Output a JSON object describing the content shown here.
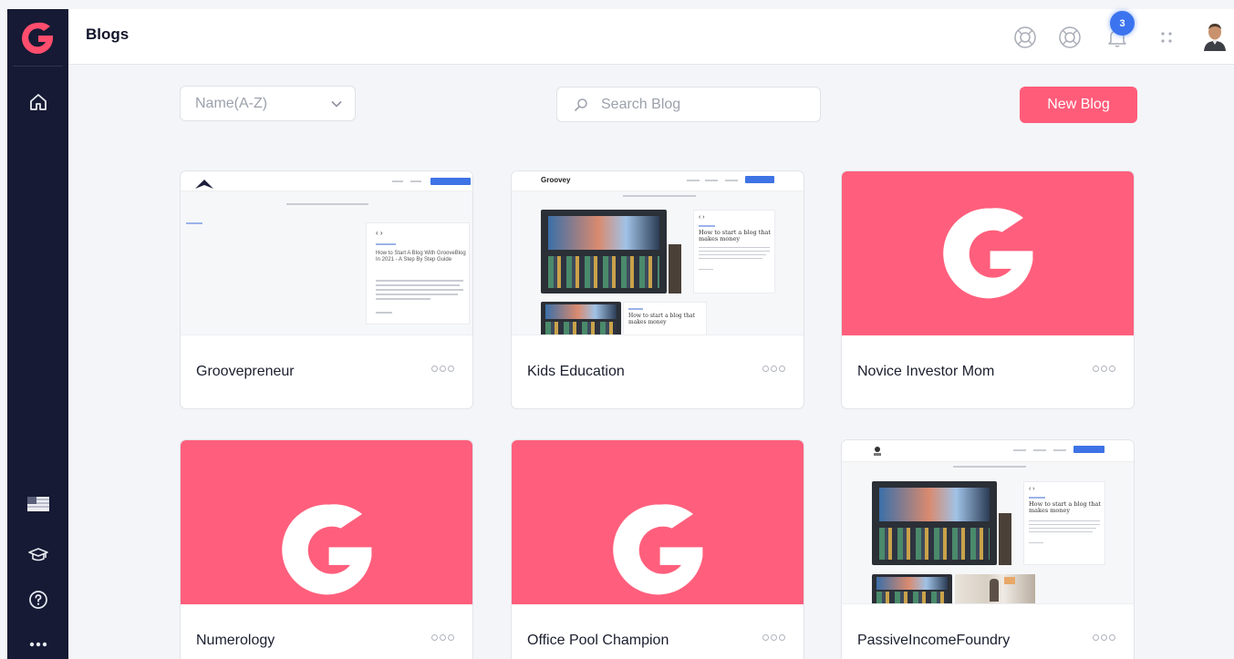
{
  "header": {
    "title": "Blogs",
    "notification_count": "3"
  },
  "controls": {
    "sort_value": "Name(A-Z)",
    "search_placeholder": "Search Blog",
    "new_button": "New Blog"
  },
  "colors": {
    "accent": "#ff5c7a",
    "sidebar": "#161a34",
    "badge": "#3b74ee"
  },
  "sidebar": {
    "icons": [
      "home-icon",
      "flag-icon",
      "graduation-cap-icon",
      "help-icon",
      "more-icon"
    ]
  },
  "blogs": [
    {
      "title": "Groovepreneur",
      "thumbnail": "screenshot"
    },
    {
      "title": "Kids Education",
      "thumbnail": "screenshot"
    },
    {
      "title": "Novice Investor Mom",
      "thumbnail": "logo"
    },
    {
      "title": "Numerology",
      "thumbnail": "logo"
    },
    {
      "title": "Office Pool Champion",
      "thumbnail": "logo"
    },
    {
      "title": "PassiveIncomeFoundry",
      "thumbnail": "screenshot"
    }
  ],
  "thumb_text": {
    "groovy_brand": "Groovey",
    "post_title": "How to start a blog that makes money",
    "post_title_2": "How to Start A Blog With GrooveBlog In 2021 - A Step By Step Guide"
  }
}
